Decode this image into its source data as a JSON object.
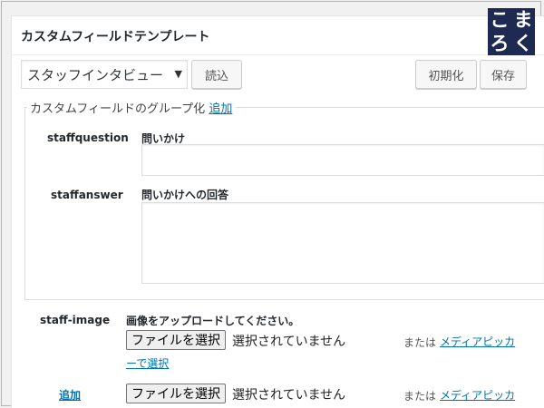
{
  "panel": {
    "title": "カスタムフィールドテンプレート"
  },
  "logo": {
    "chars": [
      "こ",
      "ま",
      "ろ",
      "く"
    ]
  },
  "toolbar": {
    "template_select": "スタッフインタビュー",
    "load_label": "読込",
    "reset_label": "初期化",
    "save_label": "保存"
  },
  "group": {
    "legend": "カスタムフィールドのグループ化",
    "add_link": "追加",
    "fields": [
      {
        "key": "staffquestion",
        "title": "問いかけ",
        "value": ""
      },
      {
        "key": "staffanswer",
        "title": "問いかけへの回答",
        "value": ""
      }
    ]
  },
  "image_field": {
    "key": "staff-image",
    "prompt": "画像をアップロードしてください。",
    "file_button": "ファイルを選択",
    "file_status": "選択されていません",
    "or_text": "または",
    "picker_link_1": "メディアピッカ",
    "picker_link_2": "ーで選択"
  },
  "image_field_2": {
    "add_link": "追加",
    "file_button": "ファイルを選択",
    "file_status": "選択されていません",
    "or_text": "または",
    "picker_link": "メディアピッカ"
  }
}
